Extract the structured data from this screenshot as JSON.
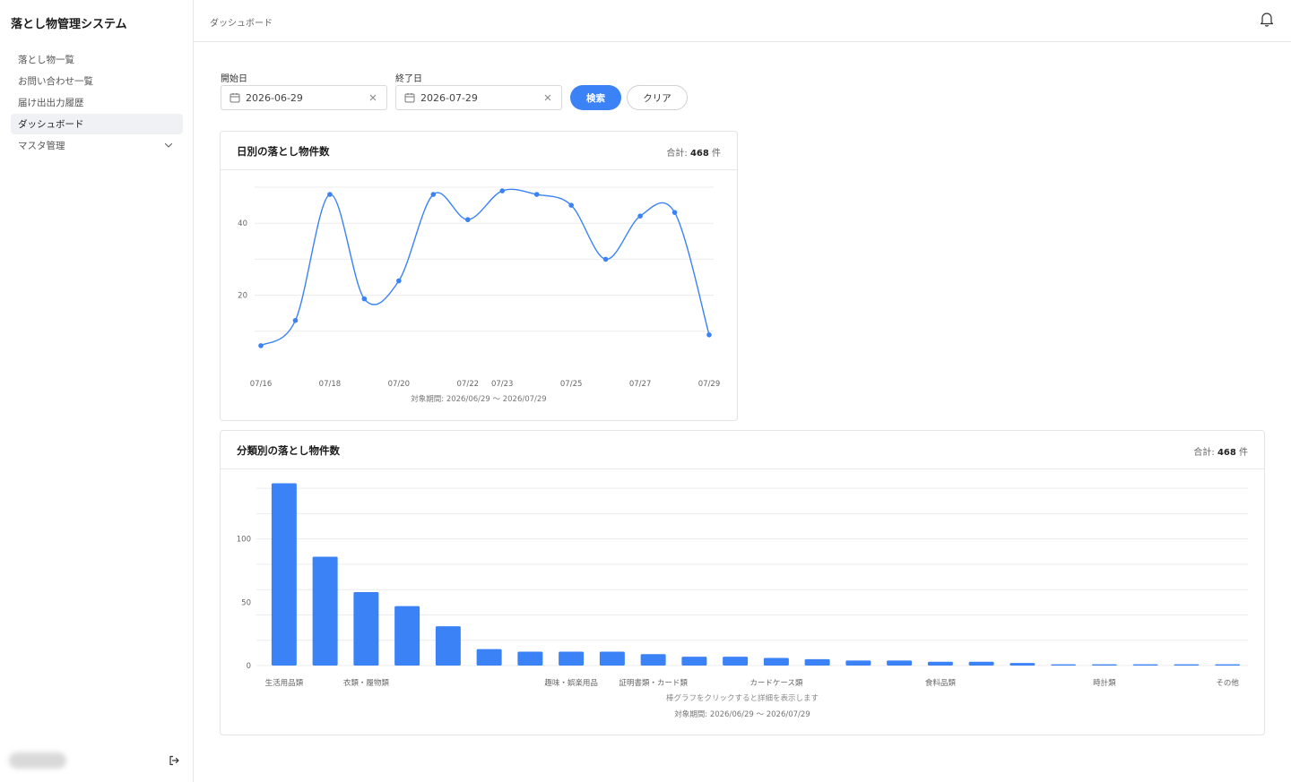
{
  "app": {
    "title": "落とし物管理システム"
  },
  "sidebar": {
    "items": [
      {
        "label": "落とし物一覧",
        "active": false
      },
      {
        "label": "お問い合わせ一覧",
        "active": false
      },
      {
        "label": "届け出出力履歴",
        "active": false
      },
      {
        "label": "ダッシュボード",
        "active": true
      },
      {
        "label": "マスタ管理",
        "active": false,
        "expandable": true
      }
    ]
  },
  "header": {
    "breadcrumb": "ダッシュボード"
  },
  "filters": {
    "start_label": "開始日",
    "start_value": "2026-06-29",
    "end_label": "終了日",
    "end_value": "2026-07-29",
    "search_label": "検索",
    "clear_label": "クリア"
  },
  "colors": {
    "accent": "#3b82f6"
  },
  "daily_card": {
    "title": "日別の落とし物件数",
    "total_prefix": "合計:",
    "total_value": "468",
    "total_unit": "件",
    "period": "対象期間: 2026/06/29 〜 2026/07/29"
  },
  "category_card": {
    "title": "分類別の落とし物件数",
    "total_prefix": "合計:",
    "total_value": "468",
    "total_unit": "件",
    "hint": "棒グラフをクリックすると詳細を表示します",
    "period": "対象期間: 2026/06/29 〜 2026/07/29"
  },
  "chart_data": [
    {
      "type": "line",
      "x": [
        "07/16",
        "07/17",
        "07/18",
        "07/19",
        "07/20",
        "07/21",
        "07/22",
        "07/23",
        "07/24",
        "07/25",
        "07/26",
        "07/27",
        "07/28",
        "07/29"
      ],
      "tick_labels": [
        "07/16",
        "07/18",
        "07/20",
        "07/22",
        "07/23",
        "07/25",
        "07/27",
        "07/29"
      ],
      "values": [
        6,
        13,
        48,
        19,
        24,
        48,
        41,
        49,
        48,
        45,
        30,
        42,
        43,
        9
      ],
      "ylim": [
        0,
        52
      ],
      "yticks": [
        20,
        40
      ],
      "grid": true
    },
    {
      "type": "bar",
      "categories": [
        "生活用品類",
        "",
        "衣類・履物類",
        "",
        "",
        "",
        "",
        "趣味・娯楽用品",
        "",
        "証明書類・カード類",
        "",
        "",
        "カードケース類",
        "",
        "",
        "",
        "食料品類",
        "",
        "",
        "",
        "時計類",
        "",
        "",
        "その他"
      ],
      "tick_labels": [
        "生活用品類",
        "衣類・履物類",
        "趣味・娯楽用品",
        "証明書類・カード類",
        "カードケース類",
        "食料品類",
        "時計類",
        "その他"
      ],
      "values": [
        144,
        86,
        58,
        47,
        31,
        13,
        11,
        11,
        11,
        9,
        7,
        7,
        6,
        5,
        4,
        4,
        3,
        3,
        2,
        1,
        1,
        1,
        1,
        1
      ],
      "ylim": [
        0,
        150
      ],
      "yticks": [
        0,
        50,
        100
      ],
      "grid": true
    }
  ]
}
